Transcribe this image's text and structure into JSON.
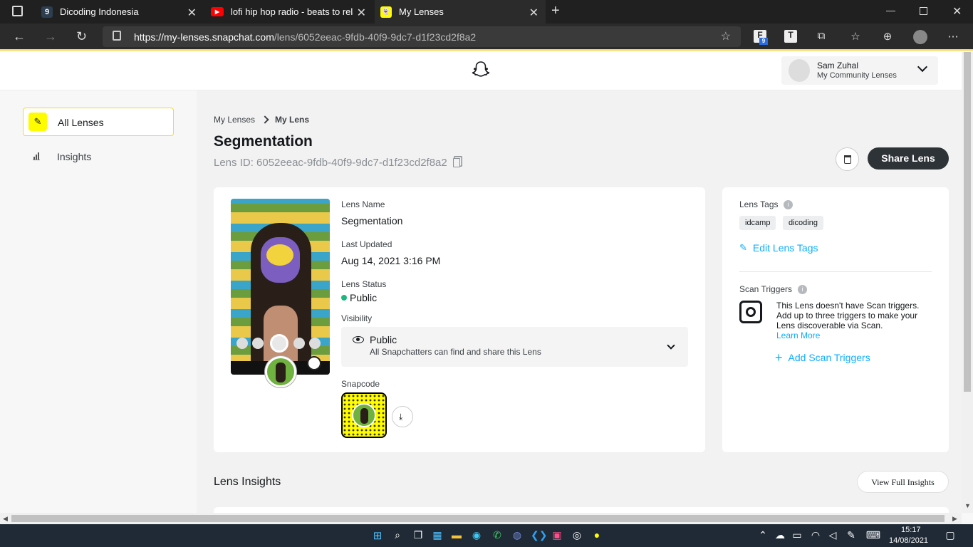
{
  "browser": {
    "tabs": [
      {
        "title": "Dicoding Indonesia",
        "favicon": "9"
      },
      {
        "title": "lofi hip hop radio - beats to relax",
        "favicon": "▶"
      },
      {
        "title": "My Lenses",
        "favicon": "👻"
      }
    ],
    "url_host": "https://my-lenses.snapchat.com",
    "url_path": "/lens/6052eeac-9fdb-40f9-9dc7-d1f23cd2f8a2",
    "ext_badge": "9"
  },
  "header": {
    "user_name": "Sam Zuhal",
    "user_sub": "My Community Lenses"
  },
  "sidebar": {
    "items": [
      {
        "label": "All Lenses"
      },
      {
        "label": "Insights"
      }
    ]
  },
  "page": {
    "breadcrumb_root": "My Lenses",
    "breadcrumb_current": "My Lens",
    "title": "Segmentation",
    "lens_id": "Lens ID: 6052eeac-9fdb-40f9-9dc7-d1f23cd2f8a2",
    "share_label": "Share Lens"
  },
  "details": {
    "name_label": "Lens Name",
    "name_value": "Segmentation",
    "updated_label": "Last Updated",
    "updated_value": "Aug 14, 2021 3:16 PM",
    "status_label": "Lens Status",
    "status_value": "Public",
    "visibility_label": "Visibility",
    "visibility_value": "Public",
    "visibility_desc": "All Snapchatters can find and share this Lens",
    "snapcode_label": "Snapcode"
  },
  "tags": {
    "label": "Lens Tags",
    "items": [
      "idcamp",
      "dicoding"
    ],
    "edit_label": "Edit Lens Tags"
  },
  "scan": {
    "label": "Scan Triggers",
    "desc": "This Lens doesn't have Scan triggers. Add up to three triggers to make your Lens discoverable via Scan.",
    "learn_more": "Learn More",
    "add_label": "Add Scan Triggers"
  },
  "insights": {
    "title": "Lens Insights",
    "view_full": "View Full Insights"
  },
  "taskbar": {
    "time": "15:17",
    "date": "14/08/2021"
  },
  "colors": {
    "snap_yellow": "#fffc00",
    "accent_blue": "#0fadff",
    "status_green": "#1bb77c",
    "dark_button": "#2e3338"
  }
}
